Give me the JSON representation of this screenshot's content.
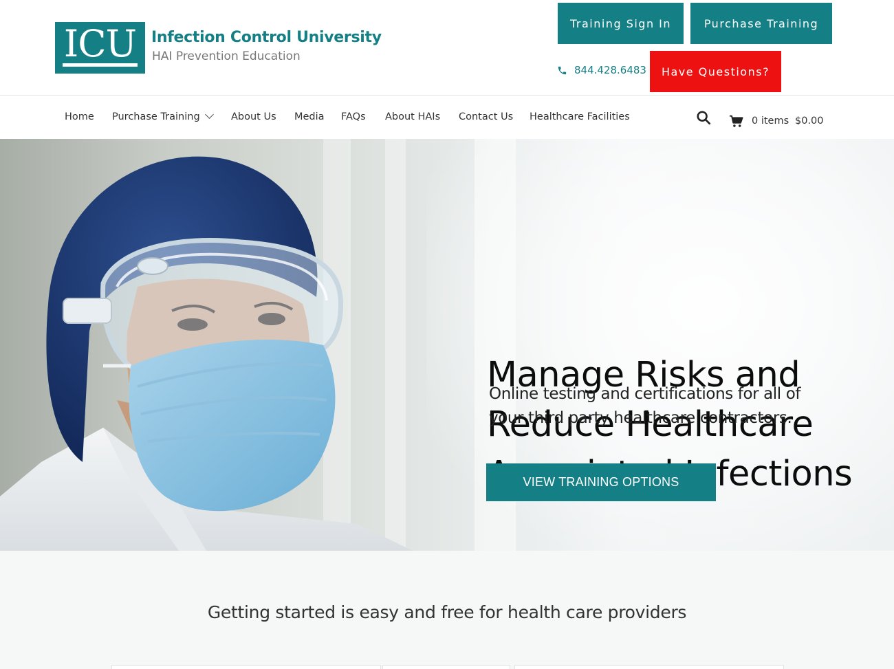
{
  "brand": {
    "logo_letters": "ICU",
    "name": "Infection Control University",
    "tagline": "HAI Prevention Education",
    "color": "#157f86"
  },
  "header": {
    "training_sign_in": "Training Sign In",
    "purchase_training": "Purchase Training",
    "phone": "844.428.6483",
    "have_questions": "Have Questions?",
    "questions_color": "#ee1111"
  },
  "nav": {
    "items": [
      {
        "label": "Home"
      },
      {
        "label": "Purchase Training"
      },
      {
        "label": "About Us"
      },
      {
        "label": "Media"
      },
      {
        "label": "FAQs"
      },
      {
        "label": "About HAIs"
      },
      {
        "label": "Contact Us"
      },
      {
        "label": "Healthcare Facilities"
      }
    ],
    "cart_count": "0 items",
    "cart_total": "$0.00"
  },
  "hero": {
    "heading_lines": [
      "Manage Risks and",
      "Reduce Healthcare",
      "Associated Infections"
    ],
    "sub_lines": [
      "Online testing and certifications for all of",
      "your third party healthcare contractors."
    ],
    "cta": "VIEW TRAINING OPTIONS"
  },
  "section": {
    "title": "Getting started is easy and free for health care providers"
  }
}
